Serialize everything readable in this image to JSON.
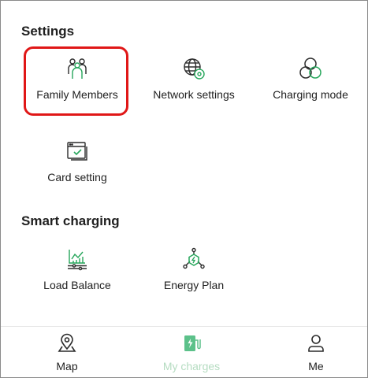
{
  "settings": {
    "title": "Settings",
    "items": [
      {
        "label": "Family Members",
        "icon": "family-members-icon"
      },
      {
        "label": "Network settings",
        "icon": "network-settings-icon"
      },
      {
        "label": "Charging mode",
        "icon": "charging-mode-icon"
      },
      {
        "label": "Card setting",
        "icon": "card-setting-icon"
      }
    ]
  },
  "smart_charging": {
    "title": "Smart charging",
    "items": [
      {
        "label": "Load Balance",
        "icon": "load-balance-icon"
      },
      {
        "label": "Energy Plan",
        "icon": "energy-plan-icon"
      }
    ]
  },
  "tabbar": {
    "items": [
      {
        "label": "Map",
        "icon": "map-pin-icon",
        "active": false
      },
      {
        "label": "My charges",
        "icon": "charger-icon",
        "active": true
      },
      {
        "label": "Me",
        "icon": "user-icon",
        "active": false
      }
    ]
  },
  "colors": {
    "icon_green": "#26a65b",
    "icon_dark": "#2b2b2b",
    "highlight_red": "#e01717",
    "active_tab_label": "#b5dcc1",
    "active_tab_icon": "#5cc18a"
  }
}
